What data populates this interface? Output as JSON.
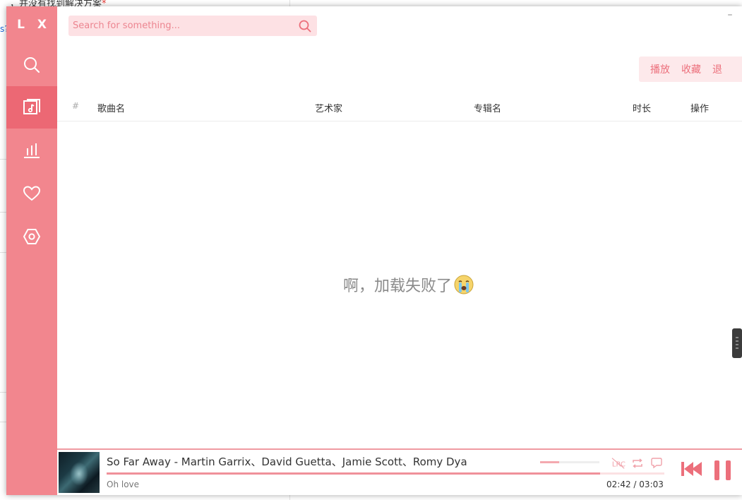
{
  "background_page": {
    "text": "，并没有找到解决方案",
    "required_mark": "*",
    "link_fragment": "s?"
  },
  "app": {
    "logo": "L X",
    "sidebar": {
      "items": [
        {
          "name": "search",
          "icon": "search-icon",
          "active": false
        },
        {
          "name": "playlist",
          "icon": "music-list-icon",
          "active": true
        },
        {
          "name": "leaderboard",
          "icon": "chart-bars-icon",
          "active": false
        },
        {
          "name": "favorites",
          "icon": "heart-icon",
          "active": false
        },
        {
          "name": "settings",
          "icon": "hexagon-gear-icon",
          "active": false
        }
      ]
    },
    "search": {
      "placeholder": "Search for something...",
      "value": ""
    },
    "window_controls": {
      "minimize": "–"
    },
    "actions": {
      "play": "播放",
      "collect": "收藏",
      "remove": "退"
    },
    "table": {
      "headers": {
        "index": "#",
        "name": "歌曲名",
        "artist": "艺术家",
        "album": "专辑名",
        "duration": "时长",
        "operation": "操作"
      }
    },
    "empty_message": "啊，加载失败了",
    "colors": {
      "sidebar": "#f2868e",
      "sidebar_active": "#ec6874",
      "accent": "#ec6f7b",
      "search_bg": "#fde1e4"
    }
  },
  "player": {
    "title": "So Far Away - Martin Garrix、David Guetta、Jamie Scott、Romy Dya",
    "lyric": "Oh love",
    "current_time": "02:42",
    "separator": "/",
    "total_time": "03:03",
    "progress": 0.885,
    "volume": 0.32,
    "controls": {
      "lrc": "LRC"
    }
  }
}
